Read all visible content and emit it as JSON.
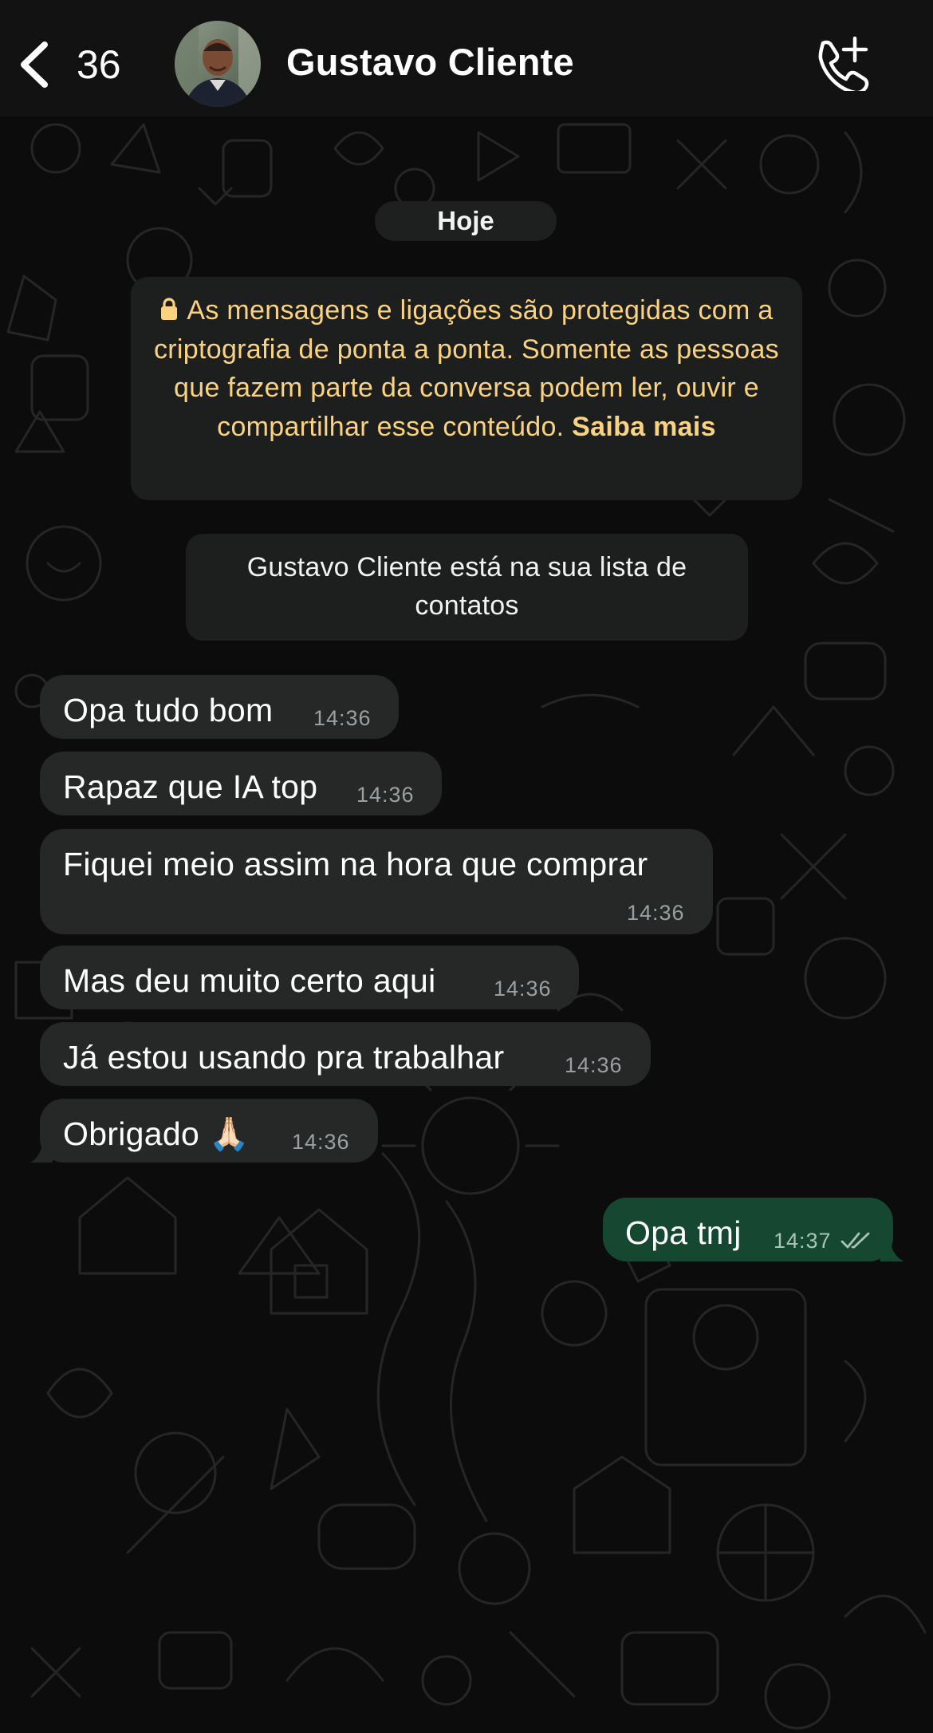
{
  "header": {
    "unread_count": "36",
    "contact_name": "Gustavo Cliente"
  },
  "chat": {
    "day_label": "Hoje",
    "encryption_notice": "As mensagens e ligações são protegidas com a criptografia de ponta a ponta. Somente as pessoas que fazem parte da conversa podem ler, ouvir e compartilhar esse conteúdo.",
    "encryption_link": "Saiba mais",
    "contact_notice": "Gustavo Cliente está na sua lista de contatos",
    "messages": [
      {
        "direction": "in",
        "text": "Opa tudo bom",
        "time": "14:36"
      },
      {
        "direction": "in",
        "text": "Rapaz que IA top",
        "time": "14:36"
      },
      {
        "direction": "in",
        "text": "Fiquei meio assim na hora que comprar",
        "time": "14:36"
      },
      {
        "direction": "in",
        "text": "Mas deu muito certo aqui",
        "time": "14:36"
      },
      {
        "direction": "in",
        "text": "Já estou usando pra trabalhar",
        "time": "14:36"
      },
      {
        "direction": "in",
        "text": "Obrigado 🙏🏻",
        "time": "14:36"
      },
      {
        "direction": "out",
        "text": "Opa tmj",
        "time": "14:37",
        "status": "read"
      }
    ]
  },
  "colors": {
    "header_bg": "#121212",
    "incoming_bubble": "#262828",
    "outgoing_bubble": "#154731",
    "notice_text": "#fbd380",
    "timestamp": "#9aa0a2"
  },
  "icons": {
    "back": "chevron-left-icon",
    "call": "phone-plus-icon",
    "lock": "lock-icon",
    "read_status": "double-check-icon"
  }
}
